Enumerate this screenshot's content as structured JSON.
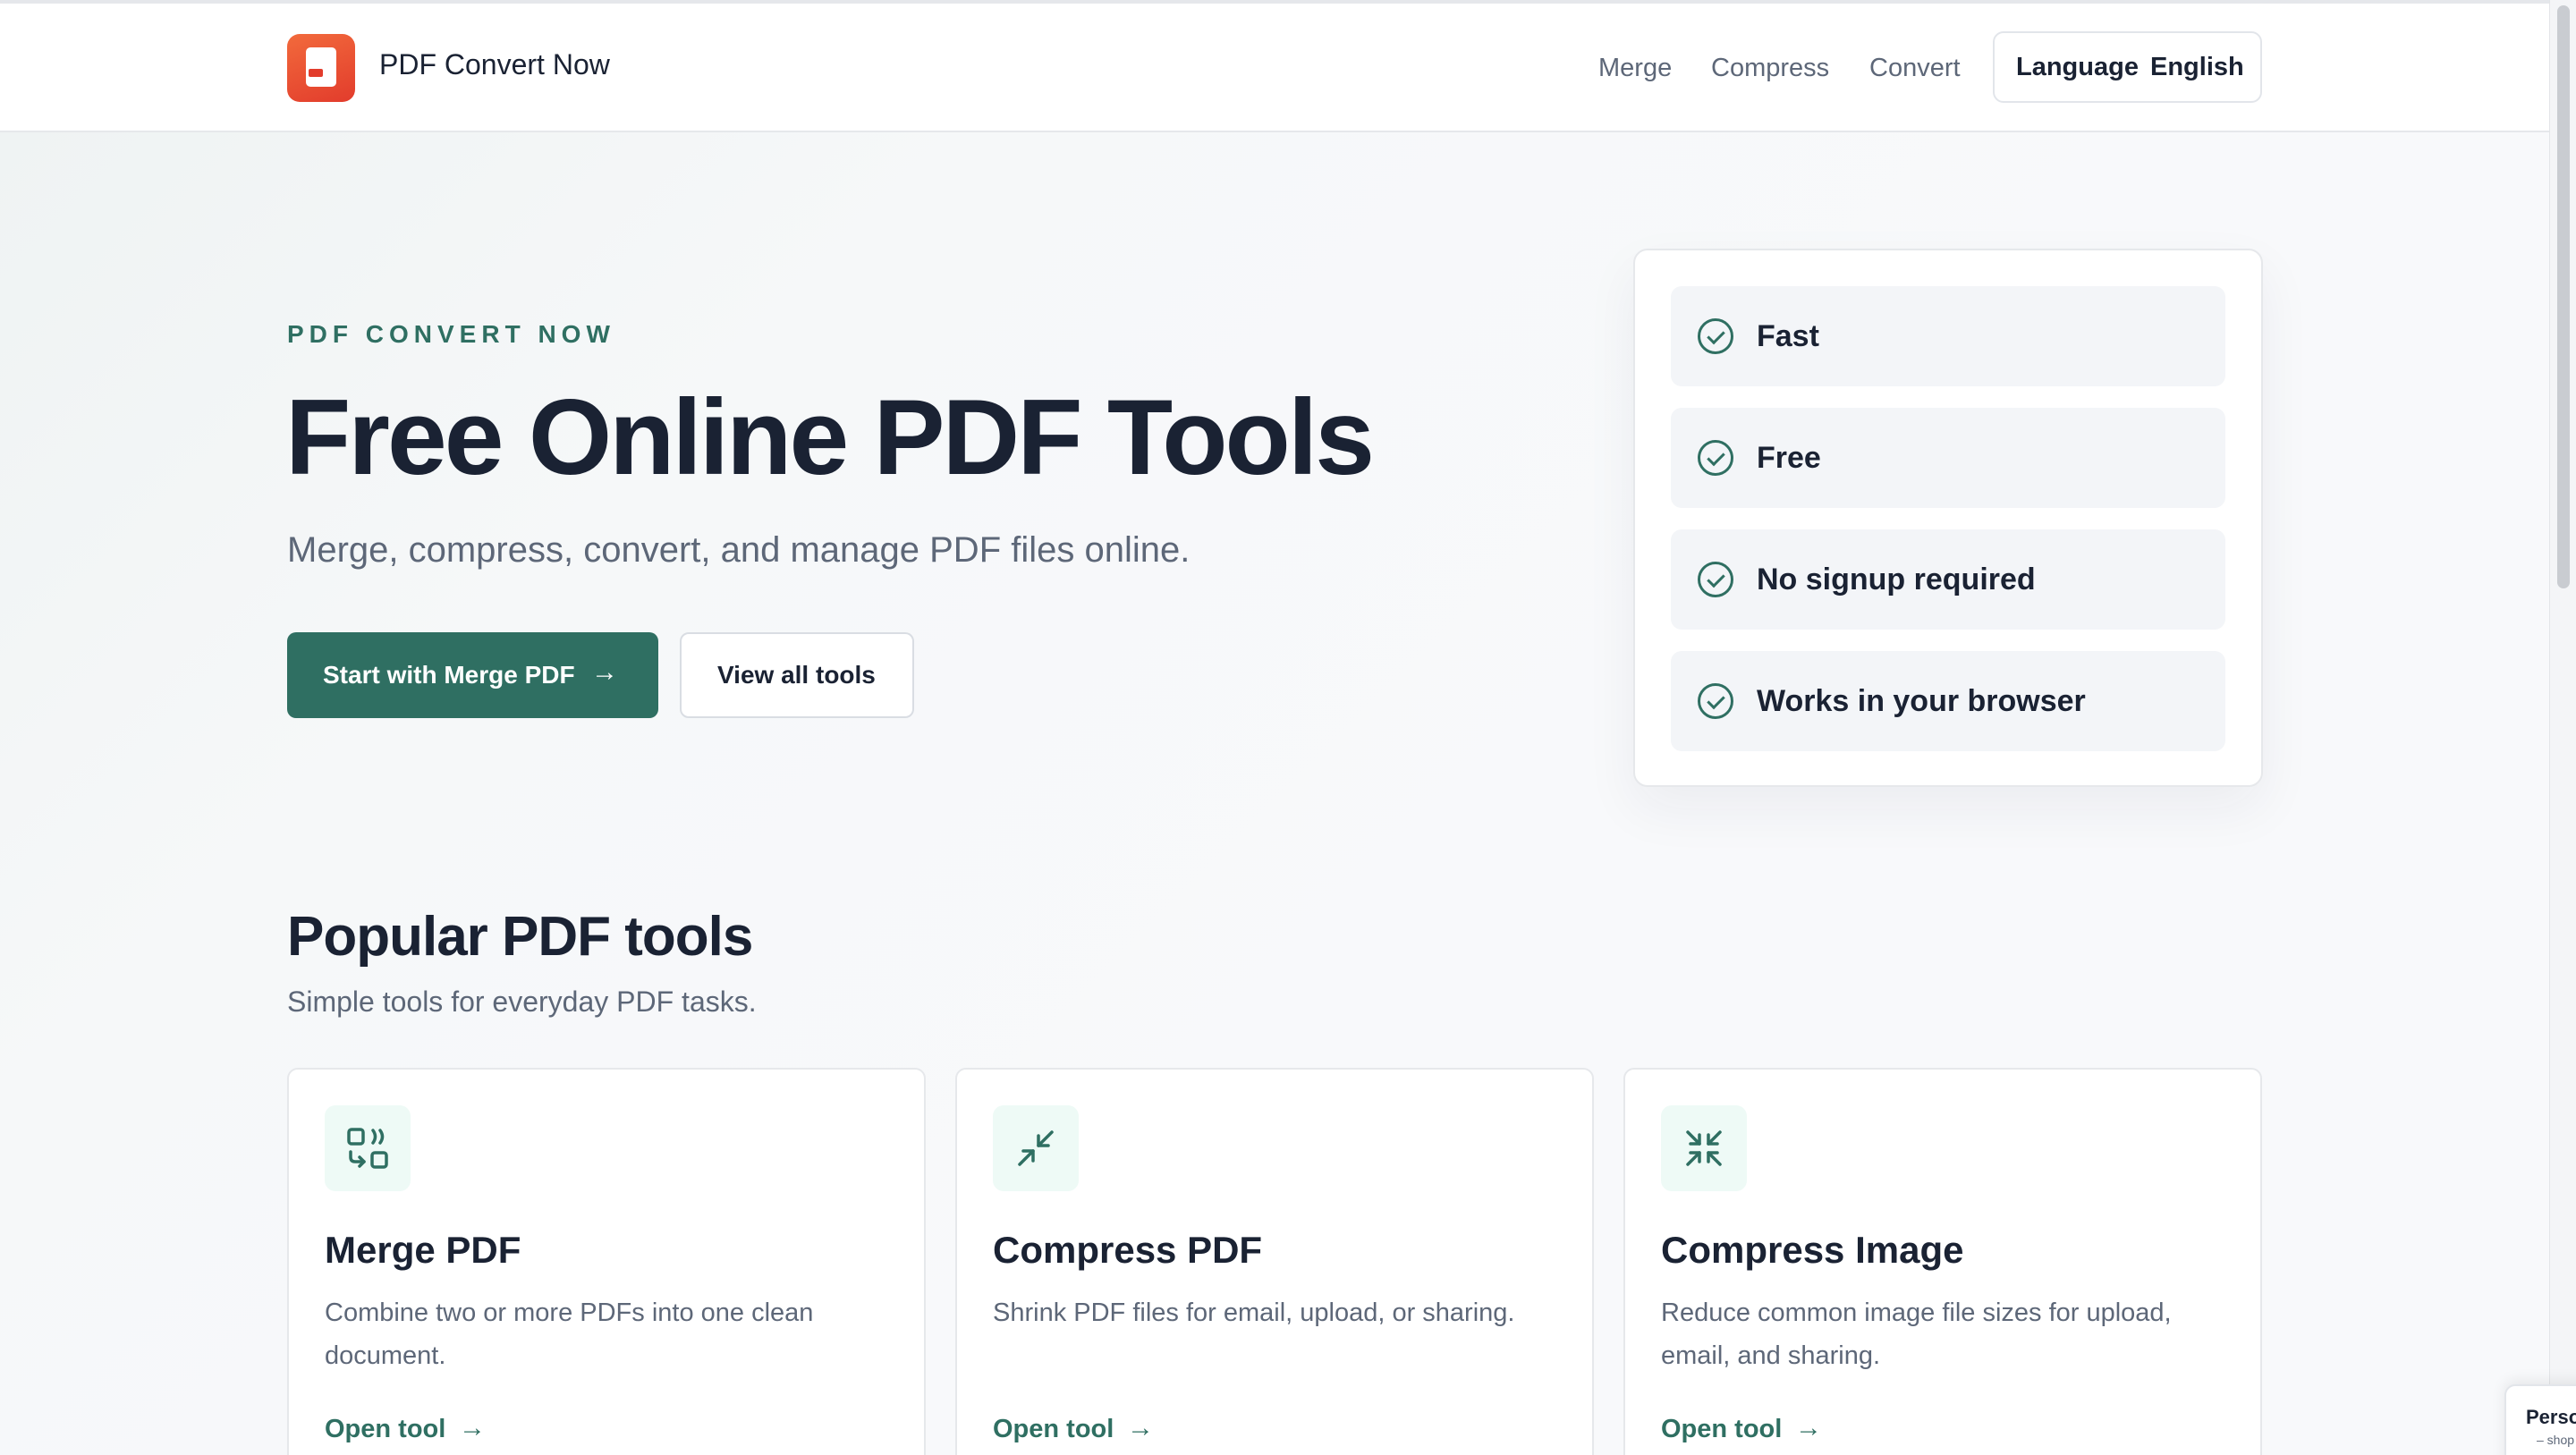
{
  "header": {
    "brand": "PDF Convert Now",
    "nav": [
      "Merge",
      "Compress",
      "Convert"
    ],
    "language_label": "Language",
    "language_value": "English"
  },
  "hero": {
    "eyebrow": "PDF CONVERT NOW",
    "title": "Free Online PDF Tools",
    "subtitle": "Merge, compress, convert, and manage PDF files online.",
    "primary_button": "Start with Merge PDF",
    "secondary_button": "View all tools"
  },
  "features": [
    "Fast",
    "Free",
    "No signup required",
    "Works in your browser"
  ],
  "tools_section": {
    "title": "Popular PDF tools",
    "subtitle": "Simple tools for everyday PDF tasks.",
    "cards": [
      {
        "name": "Merge PDF",
        "description": "Combine two or more PDFs into one clean document.",
        "link": "Open tool",
        "icon": "merge-icon"
      },
      {
        "name": "Compress PDF",
        "description": "Shrink PDF files for email, upload, or sharing.",
        "link": "Open tool",
        "icon": "compress-icon"
      },
      {
        "name": "Compress Image",
        "description": "Reduce common image file sizes for upload, email, and sharing.",
        "link": "Open tool",
        "icon": "compress-image-icon"
      }
    ]
  },
  "consent_widget": {
    "title": "Perso",
    "text": "– shop"
  },
  "colors": {
    "accent": "#2f6f62",
    "logo": "#e23c2c",
    "text": "#1a2233",
    "muted": "#5d6778"
  }
}
